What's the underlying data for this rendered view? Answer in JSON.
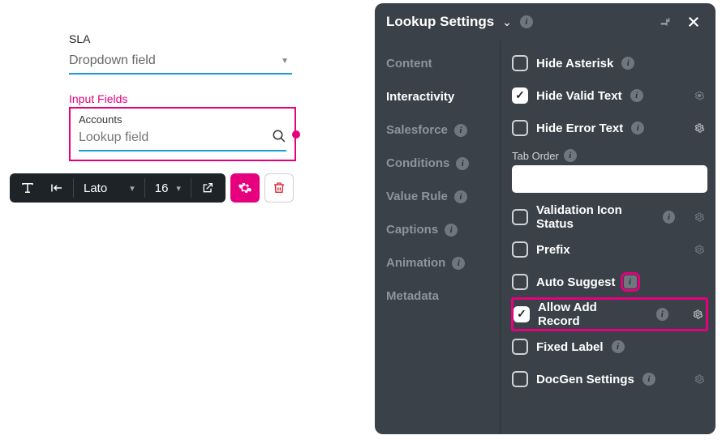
{
  "canvas": {
    "sla_label": "SLA",
    "sla_placeholder": "Dropdown field",
    "section_label": "Input Fields",
    "accounts_label": "Accounts",
    "lookup_placeholder": "Lookup field"
  },
  "toolbar": {
    "font": "Lato",
    "size": "16"
  },
  "panel": {
    "title": "Lookup Settings",
    "tabs": {
      "content": "Content",
      "interactivity": "Interactivity",
      "salesforce": "Salesforce",
      "conditions": "Conditions",
      "value_rule": "Value Rule",
      "captions": "Captions",
      "animation": "Animation",
      "metadata": "Metadata"
    },
    "options": {
      "hide_asterisk": "Hide Asterisk",
      "hide_valid_text": "Hide Valid Text",
      "hide_error_text": "Hide Error Text",
      "tab_order": "Tab Order",
      "validation_icon_status": "Validation Icon Status",
      "prefix": "Prefix",
      "auto_suggest": "Auto Suggest",
      "allow_add_record": "Allow Add Record",
      "fixed_label": "Fixed Label",
      "docgen_settings": "DocGen Settings"
    },
    "checked": {
      "hide_asterisk": false,
      "hide_valid_text": true,
      "hide_error_text": false,
      "validation_icon_status": false,
      "prefix": false,
      "auto_suggest": false,
      "allow_add_record": true,
      "fixed_label": false,
      "docgen_settings": false
    },
    "tab_order_value": ""
  }
}
